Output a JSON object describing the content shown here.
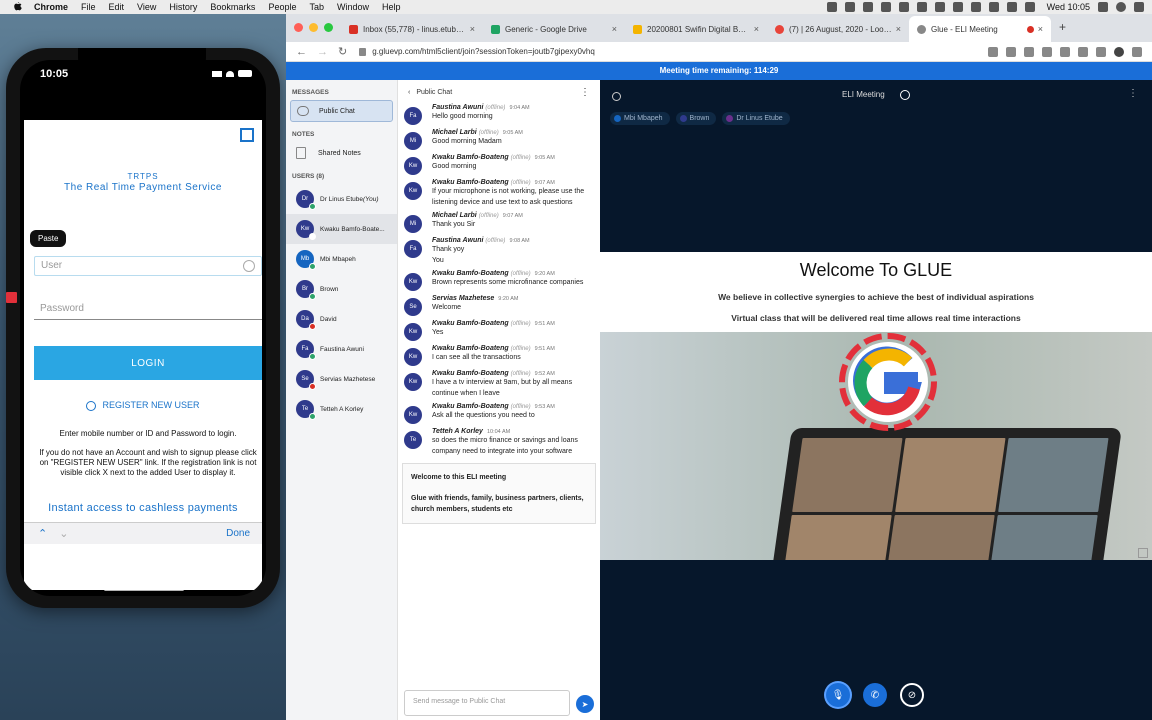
{
  "menubar": {
    "app": "Chrome",
    "items": [
      "File",
      "Edit",
      "View",
      "History",
      "Bookmarks",
      "People",
      "Tab",
      "Window",
      "Help"
    ],
    "clock": "Wed 10:05"
  },
  "phone": {
    "time": "10:05",
    "brand_small": "TRTPS",
    "brand_title": "The Real Time Payment Service",
    "paste_label": "Paste",
    "user_placeholder": "User",
    "password_placeholder": "Password",
    "login_label": "LOGIN",
    "register_label": "REGISTER NEW USER",
    "help_line1": "Enter mobile number or ID and Password to login.",
    "help_line2": "If you do not have an Account and wish to signup please click on \"REGISTER NEW USER\" link. If the registration link is not visible click X next to the added User to display it.",
    "tagline": "Instant access to cashless payments",
    "kb_up": "⌃",
    "kb_down": "⌄",
    "kb_done": "Done"
  },
  "browser": {
    "tabs": [
      {
        "label": "Inbox (55,778) - linus.etube@...",
        "color": "#d93025"
      },
      {
        "label": "Generic - Google Drive",
        "color": "#1fa463"
      },
      {
        "label": "20200801 Swifin Digital Bankin...",
        "color": "#f4b400"
      },
      {
        "label": "(7) | 26 August, 2020 - Loom...",
        "color": "#e8443a"
      },
      {
        "label": "Glue - ELI Meeting",
        "color": "#888888"
      }
    ],
    "url": "g.gluevp.com/html5client/join?sessionToken=joutb7gipexy0vhq",
    "meeting_time": "Meeting time remaining: 114:29"
  },
  "left_panel": {
    "messages_title": "MESSAGES",
    "public_chat": "Public Chat",
    "notes_title": "NOTES",
    "shared_notes": "Shared Notes",
    "users_title": "USERS (8)",
    "users": [
      {
        "initials": "Dr",
        "name": "Dr Linus Etube",
        "you": " (You)",
        "color": "#2f3a8c",
        "status": "#2fa36b"
      },
      {
        "initials": "Kw",
        "name": "Kwaku Bamfo-Boate...",
        "you": "",
        "color": "#2f3a8c",
        "status": "#ffffff"
      },
      {
        "initials": "Mb",
        "name": "Mbi Mbapeh",
        "you": "",
        "color": "#1565c0",
        "status": "#2fa36b"
      },
      {
        "initials": "Br",
        "name": "Brown",
        "you": "",
        "color": "#2f3a8c",
        "status": "#2fa36b"
      },
      {
        "initials": "Da",
        "name": "David",
        "you": "",
        "color": "#2f3a8c",
        "status": "#d93025"
      },
      {
        "initials": "Fa",
        "name": "Faustina Awuni",
        "you": "",
        "color": "#2f3a8c",
        "status": "#2fa36b"
      },
      {
        "initials": "Se",
        "name": "Servias Mazhetese",
        "you": "",
        "color": "#2f3a8c",
        "status": "#d93025"
      },
      {
        "initials": "Te",
        "name": "Tetteh A Korley",
        "you": "",
        "color": "#2f3a8c",
        "status": "#2fa36b"
      }
    ]
  },
  "chat": {
    "title": "Public Chat",
    "messages": [
      {
        "initials": "Fa",
        "name": "Faustina Awuni",
        "offline": true,
        "time": "9:04 AM",
        "lines": [
          "Hello good morning"
        ]
      },
      {
        "initials": "Mi",
        "name": "Michael Larbi",
        "offline": true,
        "time": "9:05 AM",
        "lines": [
          "Good morning Madam"
        ]
      },
      {
        "initials": "Kw",
        "name": "Kwaku Bamfo-Boateng",
        "offline": true,
        "time": "9:05 AM",
        "lines": [
          "Good morning"
        ]
      },
      {
        "initials": "Kw",
        "name": "Kwaku Bamfo-Boateng",
        "offline": true,
        "time": "9:07 AM",
        "lines": [
          "If your microphone is not working, please use the listening device and use text to ask questions"
        ]
      },
      {
        "initials": "Mi",
        "name": "Michael Larbi",
        "offline": true,
        "time": "9:07 AM",
        "lines": [
          "Thank you Sir"
        ]
      },
      {
        "initials": "Fa",
        "name": "Faustina Awuni",
        "offline": true,
        "time": "9:08 AM",
        "lines": [
          "Thank yoy",
          "You"
        ]
      },
      {
        "initials": "Kw",
        "name": "Kwaku Bamfo-Boateng",
        "offline": true,
        "time": "9:20 AM",
        "lines": [
          "Brown represents some microfinance companies"
        ]
      },
      {
        "initials": "Se",
        "name": "Servias Mazhetese",
        "offline": false,
        "time": "9:20 AM",
        "lines": [
          "Welcome"
        ]
      },
      {
        "initials": "Kw",
        "name": "Kwaku Bamfo-Boateng",
        "offline": true,
        "time": "9:51 AM",
        "lines": [
          "Yes"
        ]
      },
      {
        "initials": "Kw",
        "name": "Kwaku Bamfo-Boateng",
        "offline": true,
        "time": "9:51 AM",
        "lines": [
          "I can see all the transactions"
        ]
      },
      {
        "initials": "Kw",
        "name": "Kwaku Bamfo-Boateng",
        "offline": true,
        "time": "9:52 AM",
        "lines": [
          "I have a tv interview at 9am, but by all means continue when I leave"
        ]
      },
      {
        "initials": "Kw",
        "name": "Kwaku Bamfo-Boateng",
        "offline": true,
        "time": "9:53 AM",
        "lines": [
          "Ask all the questions you need to"
        ]
      },
      {
        "initials": "Te",
        "name": "Tetteh A Korley",
        "offline": false,
        "time": "10:04 AM",
        "lines": [
          "so does the micro finance or savings and loans company need to integrate into your software"
        ]
      }
    ],
    "offline_label": "(offline)",
    "welcome_title": "Welcome to this ELI meeting",
    "welcome_body": "Glue with friends, family, business partners, clients, church members, students etc",
    "input_placeholder": "Send message to Public Chat"
  },
  "stage": {
    "title": "ELI Meeting",
    "talkers": [
      {
        "name": "Mbi Mbapeh",
        "color": "#1565c0"
      },
      {
        "name": "Brown",
        "color": "#2f3a8c"
      },
      {
        "name": "Dr Linus Etube",
        "color": "#6a2f8c"
      }
    ],
    "slide_title": "Welcome To GLUE",
    "slide_line1": "We believe in collective synergies to achieve the best of individual aspirations",
    "slide_line2": "Virtual class that will be delivered real time allows real time interactions"
  }
}
